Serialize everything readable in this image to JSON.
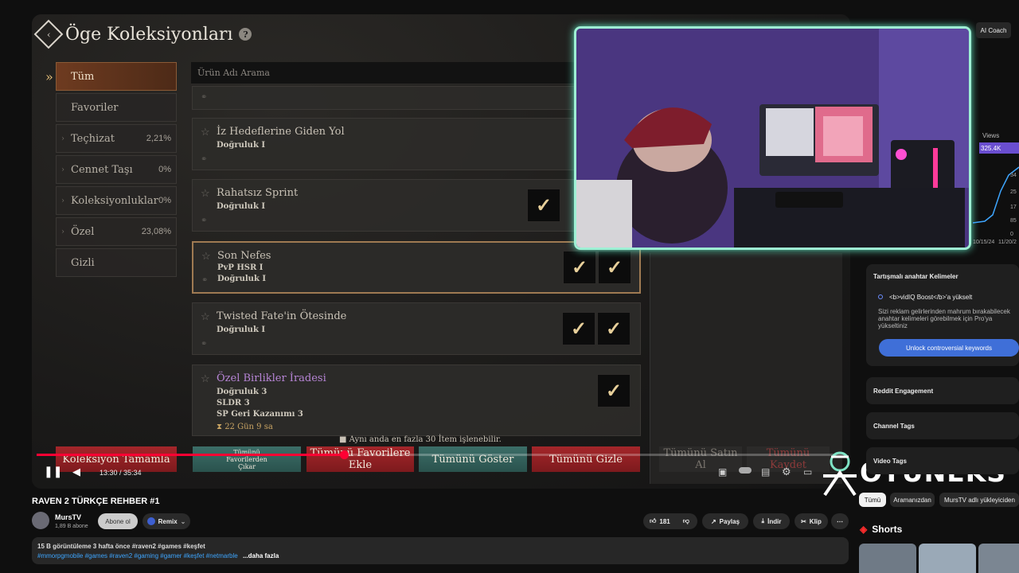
{
  "game": {
    "title": "Öge Koleksiyonları",
    "help_icon": "?",
    "categories": [
      {
        "label": "Tüm",
        "pct": "",
        "active": true
      },
      {
        "label": "Favoriler",
        "pct": ""
      },
      {
        "label": "Teçhizat",
        "pct": "2,21%"
      },
      {
        "label": "Cennet Taşı",
        "pct": "0%"
      },
      {
        "label": "Koleksiyonluklar",
        "pct": "0%"
      },
      {
        "label": "Özel",
        "pct": "23,08%"
      },
      {
        "label": "Gizli",
        "pct": ""
      }
    ],
    "search_placeholder": "Ürün Adı Arama",
    "items": [
      {
        "name": "İz Hedeflerine Giden Yol",
        "stats": [
          "Doğruluk I"
        ]
      },
      {
        "name": "Rahatsız Sprint",
        "stats": [
          "Doğruluk I"
        ]
      },
      {
        "name": "Son Nefes",
        "stats": [
          "PvP HSR I",
          "Doğruluk I"
        ]
      },
      {
        "name": "Twisted Fate'in Ötesinde",
        "stats": [
          "Doğruluk I"
        ]
      },
      {
        "name": "Özel Birlikler İradesi",
        "stats": [
          "Doğruluk 3",
          "SLDR 3",
          "SP Geri Kazanımı 3"
        ],
        "timer": "⧗ 22 Gün 9 sa"
      }
    ],
    "notice": "■ Aynı anda en fazla 30 İtem işlenebilir.",
    "buttons": {
      "complete": "Koleksiyon Tamamla",
      "remove_fav": "Tümünü Favorilerden Çıkar",
      "add_fav": "Tümünü Favorilere Ekle",
      "show_all": "Tümünü Göster",
      "hide_all": "Tümünü Gizle",
      "buy_all": "Tümünü Satın Al",
      "save_all": "Tümünü Kaydet"
    }
  },
  "player": {
    "time": "13:30 / 35:34",
    "progress": 0.38
  },
  "brand": {
    "logo_text": "OYUNEKS"
  },
  "sidebar": {
    "ai_coach": "AI Coach",
    "views_label": "Views",
    "views_value": "325.4K",
    "dates": [
      "10/15/24",
      "11/20/2"
    ],
    "y_ticks": [
      "34",
      "25",
      "17",
      "85",
      "0"
    ],
    "keywords_title": "Tartışmalı anahtar Kelimeler",
    "boost_text": "<b>vidIQ Boost</b>'a yükselt",
    "boost_desc": "Sizi reklam gelirlerinden mahrum bırakabilecek anahtar kelimeleri görebilmek için Pro'ya yükseltiniz",
    "unlock_btn": "Unlock controversial keywords",
    "reddit": "Reddit Engagement",
    "channel_tags": "Channel Tags",
    "video_tags": "Video Tags",
    "filters": [
      "Tümü",
      "Aramanızdan",
      "MursTV adlı yükleyiciden"
    ],
    "shorts": "Shorts"
  },
  "video": {
    "title": "RAVEN 2 TÜRKÇE REHBER #1",
    "channel": "MursTV",
    "subs": "1,89 B abone",
    "subscribe": "Abone ol",
    "remix": "Remix",
    "likes": "181",
    "share": "Paylaş",
    "download": "İndir",
    "clip": "Klip",
    "meta": "15 B görüntüleme  3 hafta önce  #raven2 #games #keşfet",
    "tags": "#mmorpgmobile #games #raven2 #gaming #gamer #keşfet #netmarble",
    "more": "...daha fazla"
  }
}
